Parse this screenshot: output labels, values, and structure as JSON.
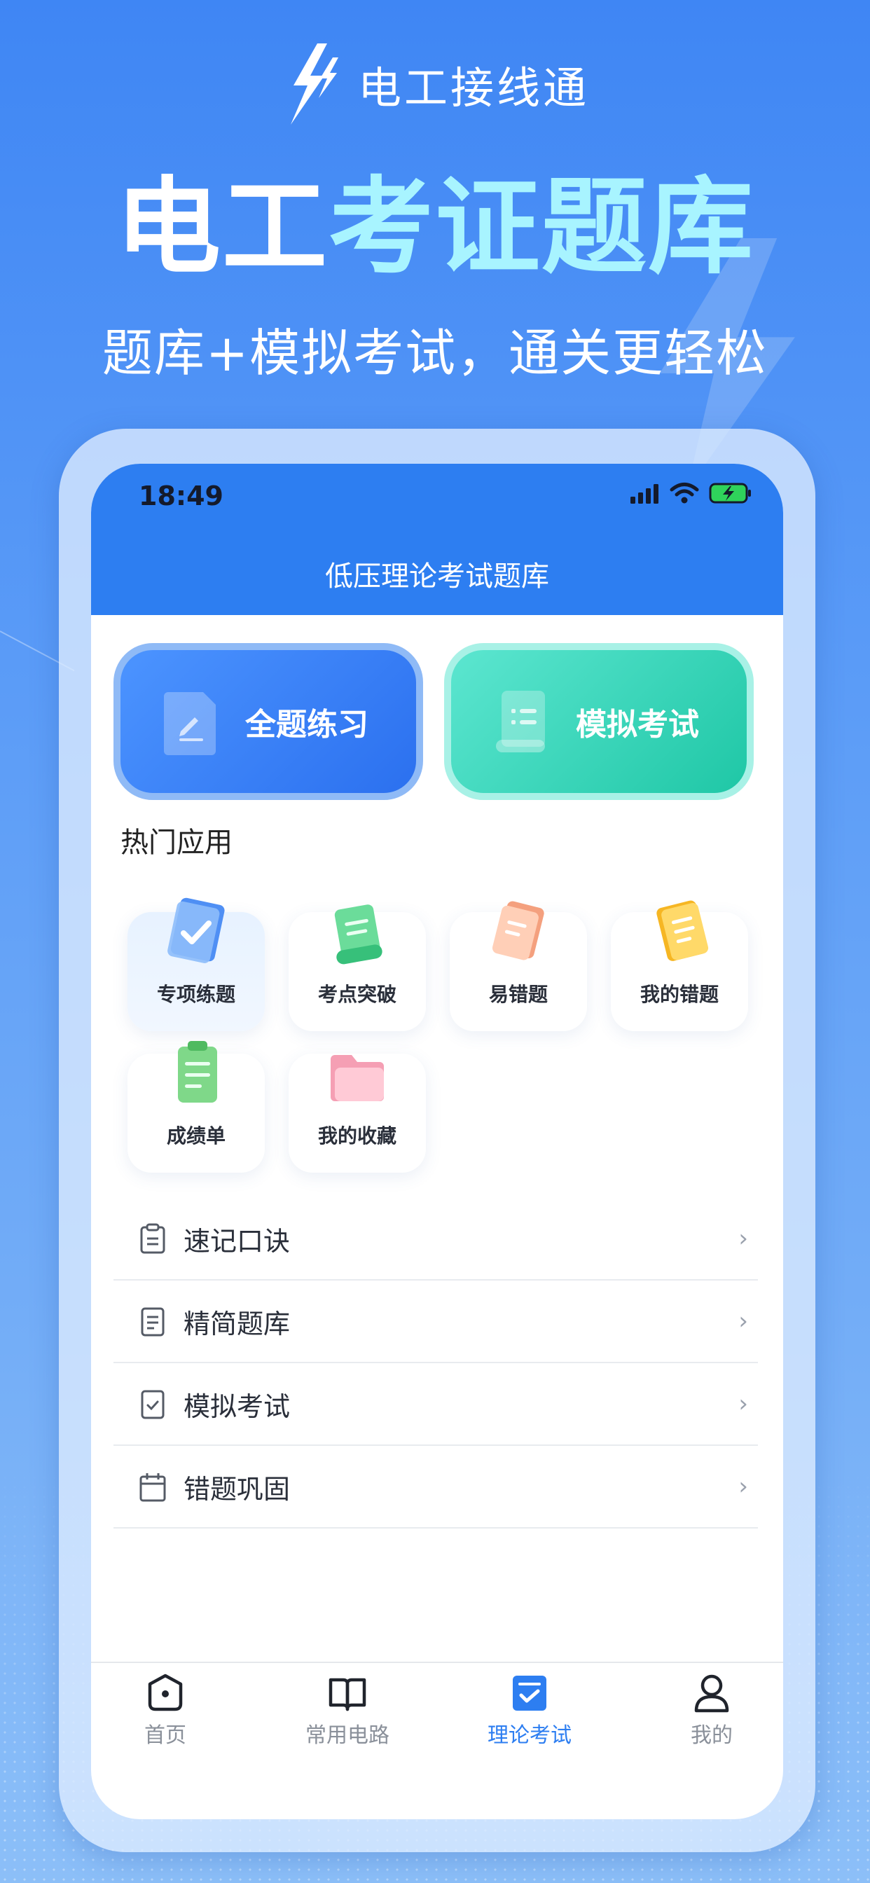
{
  "banner": {
    "app_name": "电工接线通",
    "headline_white": "电工",
    "headline_cyan": "考证题库",
    "subline": "题库+模拟考试，通关更轻松"
  },
  "status": {
    "time": "18:49"
  },
  "screen": {
    "title": "低压理论考试题库"
  },
  "primary_actions": {
    "practice_label": "全题练习",
    "exam_label": "模拟考试"
  },
  "hot_apps": {
    "title": "热门应用",
    "items": [
      {
        "label": "专项练题",
        "icon": "clipboard-check-icon"
      },
      {
        "label": "考点突破",
        "icon": "scroll-icon"
      },
      {
        "label": "易错题",
        "icon": "paper-icon"
      },
      {
        "label": "我的错题",
        "icon": "notebook-icon"
      },
      {
        "label": "成绩单",
        "icon": "report-icon"
      },
      {
        "label": "我的收藏",
        "icon": "folder-icon"
      }
    ]
  },
  "menu": {
    "items": [
      {
        "label": "速记口诀",
        "icon": "clipboard-icon"
      },
      {
        "label": "精简题库",
        "icon": "document-icon"
      },
      {
        "label": "模拟考试",
        "icon": "check-document-icon"
      },
      {
        "label": "错题巩固",
        "icon": "calendar-icon"
      }
    ],
    "chevron": "›"
  },
  "tabbar": {
    "items": [
      {
        "label": "首页",
        "icon": "home-icon"
      },
      {
        "label": "常用电路",
        "icon": "book-icon"
      },
      {
        "label": "理论考试",
        "icon": "exam-icon"
      },
      {
        "label": "我的",
        "icon": "user-icon"
      }
    ],
    "active_index": 2
  },
  "colors": {
    "accent": "#2d7ef1",
    "exam_green": "#22c9a8",
    "headline_cyan": "#a8f4ff"
  }
}
